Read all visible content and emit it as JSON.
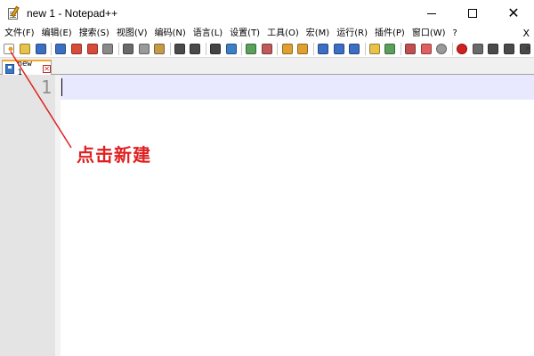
{
  "window": {
    "title": "new 1 - Notepad++",
    "minimize_icon": "minimize-icon",
    "maximize_icon": "maximize-icon",
    "close_icon": "close-icon",
    "close_glyph": "✕"
  },
  "menu": {
    "items": [
      "文件(F)",
      "编辑(E)",
      "搜索(S)",
      "视图(V)",
      "编码(N)",
      "语言(L)",
      "设置(T)",
      "工具(O)",
      "宏(M)",
      "运行(R)",
      "插件(P)",
      "窗口(W)",
      "?"
    ],
    "close_label": "X"
  },
  "toolbar": {
    "more_label": "»",
    "buttons": [
      {
        "name": "new-file-icon",
        "color": "#ffffff"
      },
      {
        "name": "open-file-icon",
        "color": "#e8c34a"
      },
      {
        "name": "save-icon",
        "color": "#3b6fc4"
      },
      {
        "name": "save-all-icon",
        "color": "#3b6fc4"
      },
      {
        "name": "close-file-icon",
        "color": "#d84a3a"
      },
      {
        "name": "close-all-icon",
        "color": "#d84a3a"
      },
      {
        "name": "print-icon",
        "color": "#8a8a8a"
      },
      {
        "name": "cut-icon",
        "color": "#6a6a6a"
      },
      {
        "name": "copy-icon",
        "color": "#9a9a9a"
      },
      {
        "name": "paste-icon",
        "color": "#c49a4a"
      },
      {
        "name": "undo-icon",
        "color": "#4a4a4a"
      },
      {
        "name": "redo-icon",
        "color": "#4a4a4a"
      },
      {
        "name": "find-icon",
        "color": "#444444"
      },
      {
        "name": "replace-icon",
        "color": "#3b7fc4"
      },
      {
        "name": "zoom-in-icon",
        "color": "#5aa05a"
      },
      {
        "name": "zoom-out-icon",
        "color": "#c05a5a"
      },
      {
        "name": "sync-vertical-icon",
        "color": "#e0a030"
      },
      {
        "name": "sync-horizontal-icon",
        "color": "#e0a030"
      },
      {
        "name": "word-wrap-icon",
        "color": "#3b6fc4"
      },
      {
        "name": "show-all-chars-icon",
        "color": "#3b6fc4"
      },
      {
        "name": "indent-guide-icon",
        "color": "#3b6fc4"
      },
      {
        "name": "doc-map-icon",
        "color": "#e8c34a"
      },
      {
        "name": "function-list-icon",
        "color": "#5aa05a"
      },
      {
        "name": "folder-workspace-icon",
        "color": "#c05050"
      },
      {
        "name": "monitoring-icon",
        "color": "#e06060"
      },
      {
        "name": "oval-icon",
        "color": "#9a9a9a"
      },
      {
        "name": "record-macro-icon",
        "color": "#d02020"
      },
      {
        "name": "stop-record-icon",
        "color": "#6a6a6a"
      },
      {
        "name": "play-macro-icon",
        "color": "#4a4a4a"
      },
      {
        "name": "play-multiple-icon",
        "color": "#4a4a4a"
      },
      {
        "name": "save-macro-icon",
        "color": "#4a4a4a"
      }
    ]
  },
  "tabs": [
    {
      "label": "new 1",
      "close_glyph": "✕"
    }
  ],
  "editor": {
    "line_numbers": [
      "1"
    ],
    "current_line_color": "#e8e8ff"
  },
  "annotation": {
    "text": "点击新建",
    "color": "#e02020"
  }
}
